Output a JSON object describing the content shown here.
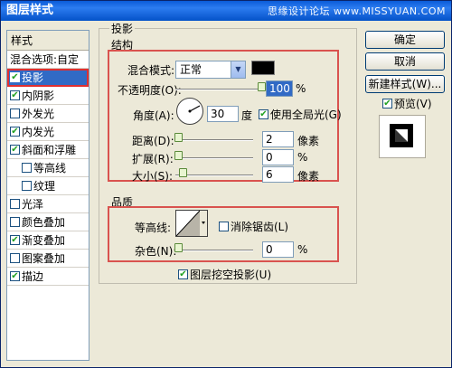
{
  "window": {
    "title": "图层样式",
    "watermark": "思缘设计论坛 www.MISSYUAN.COM"
  },
  "style_list": {
    "header": "样式",
    "items": [
      {
        "label": "混合选项:自定",
        "checkbox": false,
        "checked": false
      },
      {
        "label": "投影",
        "checkbox": true,
        "checked": true,
        "selected": true
      },
      {
        "label": "内阴影",
        "checkbox": true,
        "checked": true
      },
      {
        "label": "外发光",
        "checkbox": true,
        "checked": false
      },
      {
        "label": "内发光",
        "checkbox": true,
        "checked": true
      },
      {
        "label": "斜面和浮雕",
        "checkbox": true,
        "checked": true
      },
      {
        "label": "等高线",
        "checkbox": true,
        "checked": false,
        "indent": true
      },
      {
        "label": "纹理",
        "checkbox": true,
        "checked": false,
        "indent": true
      },
      {
        "label": "光泽",
        "checkbox": true,
        "checked": false
      },
      {
        "label": "颜色叠加",
        "checkbox": true,
        "checked": false
      },
      {
        "label": "渐变叠加",
        "checkbox": true,
        "checked": true
      },
      {
        "label": "图案叠加",
        "checkbox": true,
        "checked": false
      },
      {
        "label": "描边",
        "checkbox": true,
        "checked": true
      }
    ]
  },
  "buttons": {
    "ok": "确定",
    "cancel": "取消",
    "new_style": "新建样式(W)...",
    "preview_label": "预览(V)",
    "preview_checked": true
  },
  "panel": {
    "title": "投影",
    "structure": {
      "legend": "结构",
      "blend_mode_label": "混合模式:",
      "blend_mode_value": "正常",
      "blend_color": "#000000",
      "opacity_label": "不透明度(O):",
      "opacity_value": "100",
      "opacity_unit": "%",
      "opacity_level": 1.0,
      "angle_label": "角度(A):",
      "angle_value": "30",
      "angle_unit": "度",
      "global_light_label": "使用全局光(G)",
      "global_light_checked": true,
      "distance_label": "距离(D):",
      "distance_value": "2",
      "distance_unit": "像素",
      "spread_label": "扩展(R):",
      "spread_value": "0",
      "spread_unit": "%",
      "size_label": "大小(S):",
      "size_value": "6",
      "size_unit": "像素"
    },
    "quality": {
      "legend": "品质",
      "contour_label": "等高线:",
      "anti_alias_label": "消除锯齿(L)",
      "anti_alias_checked": false,
      "noise_label": "杂色(N):",
      "noise_value": "0",
      "noise_unit": "%"
    },
    "knockout_label": "图层挖空投影(U)",
    "knockout_checked": true
  }
}
